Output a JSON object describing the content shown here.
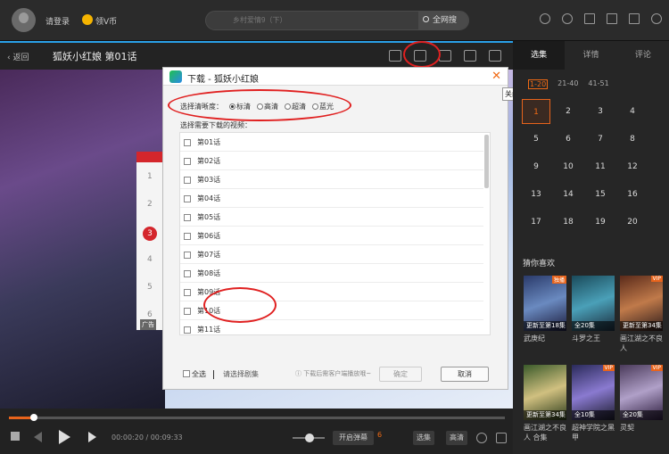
{
  "header": {
    "login": "请登录",
    "vcoin": "领V币",
    "search_placeholder": "乡村爱情9（下）",
    "search_button": "全网搜"
  },
  "player": {
    "back": "返回",
    "title": "狐妖小红娘 第01话",
    "ad": "广告",
    "ranks": [
      "1",
      "2",
      "3",
      "4",
      "5",
      "6"
    ],
    "progress": 0.05,
    "time": "00:00:20 / 00:09:33",
    "danmu": "开启弹幕",
    "danmu_count": "6",
    "select": "选集",
    "quality": "高清"
  },
  "dialog": {
    "title": "下载 - 狐妖小红娘",
    "close": "✕",
    "quality_label": "选择清晰度：",
    "quality_options": [
      "标清",
      "高清",
      "超清",
      "蓝光"
    ],
    "quality_selected": "标清",
    "select_label": "选择需要下载的视频：",
    "episodes": [
      "第01话",
      "第02话",
      "第03话",
      "第04话",
      "第05话",
      "第06话",
      "第07话",
      "第08话",
      "第09话",
      "第10话",
      "第11话"
    ],
    "select_all": "全选",
    "select_hint": "请选择剧集",
    "download_hint": "下载后需客户端播放哦~",
    "ok": "确定",
    "cancel": "取消"
  },
  "tooltip": "关闭",
  "sidebar": {
    "tabs": [
      "选集",
      "详情",
      "评论"
    ],
    "ranges": [
      "1-20",
      "21-40",
      "41-51"
    ],
    "episodes": [
      "1",
      "2",
      "3",
      "4",
      "5",
      "6",
      "7",
      "8",
      "9",
      "10",
      "11",
      "12",
      "13",
      "14",
      "15",
      "16",
      "17",
      "18",
      "19",
      "20"
    ],
    "current": "1",
    "guess_title": "猜你喜欢",
    "recommendations": [
      {
        "name": "武庚纪",
        "badge": "更新至第18集",
        "corner": "独播"
      },
      {
        "name": "斗罗之王",
        "badge": "全20集",
        "corner": ""
      },
      {
        "name": "画江湖之不良人",
        "badge": "更新至第34集",
        "corner": "VIP"
      },
      {
        "name": "画江湖之不良人 合集",
        "badge": "更新至第34集",
        "corner": ""
      },
      {
        "name": "超神学院之黑甲",
        "badge": "全10集",
        "corner": "VIP"
      },
      {
        "name": "灵契",
        "badge": "全20集",
        "corner": "VIP"
      }
    ]
  },
  "colors": {
    "accent": "#2aa0e8",
    "orange": "#f06a14",
    "annotation": "#e02020"
  }
}
